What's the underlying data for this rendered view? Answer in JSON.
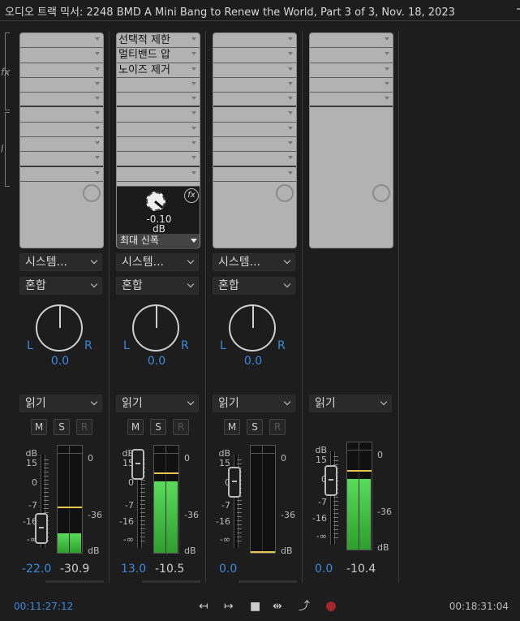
{
  "window": {
    "title": "오디오 트랙 믹서: 2248 BMD A Mini Bang to Renew the World, Part 3 of 3, Nov. 18, 2023"
  },
  "side_icons": {
    "fx": "fx",
    "send": "ꞁ"
  },
  "tracks": [
    {
      "effects": [],
      "output": "시스템...",
      "mode": "혼합",
      "pan": {
        "L": "L",
        "R": "R",
        "value": "0.0"
      },
      "automation": "읽기",
      "buttons": [
        "M",
        "S",
        "R"
      ],
      "scale_left": [
        "dB",
        "15",
        "0",
        "-7",
        "-16",
        "-∞"
      ],
      "scale_right": [
        "0",
        "-36",
        "dB"
      ],
      "volume": "-22.0",
      "peak": "-30.9",
      "meter_level": 0.2
    },
    {
      "effects": [
        "선택적 제한",
        "멀티밴드 압",
        "노이즈 제거"
      ],
      "effect_param": {
        "value": "-0.10",
        "unit": "dB",
        "name": "최대 신폭"
      },
      "output": "시스템...",
      "mode": "혼합",
      "pan": {
        "L": "L",
        "R": "R",
        "value": "0.0"
      },
      "automation": "읽기",
      "buttons": [
        "M",
        "S",
        "R"
      ],
      "scale_left": [
        "dB",
        "15",
        "0",
        "-7",
        "-16",
        "-∞"
      ],
      "scale_right": [
        "0",
        "-36",
        "dB"
      ],
      "volume": "13.0",
      "peak": "-10.5",
      "meter_level": 0.72
    },
    {
      "effects": [],
      "output": "시스템...",
      "mode": "혼합",
      "pan": {
        "L": "L",
        "R": "R",
        "value": "0.0"
      },
      "automation": "읽기",
      "buttons": [
        "M",
        "S",
        "R"
      ],
      "scale_left": [
        "dB",
        "15",
        "0",
        "-7",
        "-16",
        "-∞"
      ],
      "scale_right": [
        "0",
        "-36",
        "dB"
      ],
      "volume": "0.0",
      "peak": "",
      "meter_level": 0
    },
    {
      "effects": [],
      "automation": "읽기",
      "scale_left": [
        "dB",
        "15",
        "0",
        "-7",
        "-16",
        "-∞"
      ],
      "scale_right": [
        "0",
        "-36",
        "dB"
      ],
      "volume": "0.0",
      "peak": "-10.4",
      "meter_level": 0.71
    }
  ],
  "transport": {
    "current_time": "00:11:27:12",
    "end_time": "00:18:31:04",
    "controls": [
      "↤",
      "↦",
      "■",
      "⇹",
      "⤴"
    ]
  },
  "colors": {
    "accent": "#3b8ae0",
    "meter": "#4fcf4f",
    "peak": "#e8c64d",
    "record": "#a2262a"
  }
}
